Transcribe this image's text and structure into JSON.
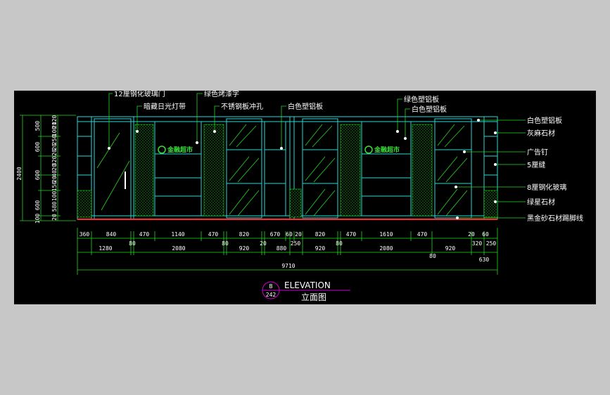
{
  "drawing": {
    "title_en": "ELEVATION",
    "title_cn": "立面图",
    "bubble_top": "B",
    "bubble_bottom": "242"
  },
  "colors": {
    "background": "#c7c7c7",
    "canvas": "#000000",
    "outline": "#27d8d8",
    "green": "#23d823",
    "white": "#ffffff",
    "magenta": "#d000d0",
    "red": "#ff2a2a"
  },
  "labels_top": [
    "12厘钢化玻璃门",
    "绿色烤漆字",
    "暗藏日光灯带",
    "不锈钢板冲孔",
    "白色塑铝板",
    "绿色塑铝板",
    "白色塑铝板"
  ],
  "labels_right": [
    "白色塑铝板",
    "灰麻石材",
    "广告钉",
    "5厘缝",
    "8厘钢化玻璃",
    "绿星石材",
    "黑金砂石材踢脚线"
  ],
  "logo_text": "金融超市",
  "dims_row1": [
    "360",
    "840",
    "470",
    "1140",
    "470",
    "820",
    "670",
    "60",
    "20",
    "820",
    "470",
    "1610",
    "470",
    "20",
    "60"
  ],
  "dims_row2": [
    "1280",
    "80",
    "2080",
    "80",
    "920",
    "20",
    "880",
    "250",
    "920",
    "80",
    "2080",
    "920",
    "320",
    "250"
  ],
  "dims_row2b": [
    "80"
  ],
  "dims_row3": [
    "630"
  ],
  "dims_total": "9710",
  "dims_left_outer": "2400",
  "dims_left": [
    "500",
    "600",
    "600",
    "600",
    "100"
  ],
  "dims_left_inner": [
    "120",
    "20",
    "100",
    "250",
    "20",
    "20",
    "320",
    "20",
    "40",
    "20",
    "150",
    "100",
    "580",
    "20"
  ]
}
